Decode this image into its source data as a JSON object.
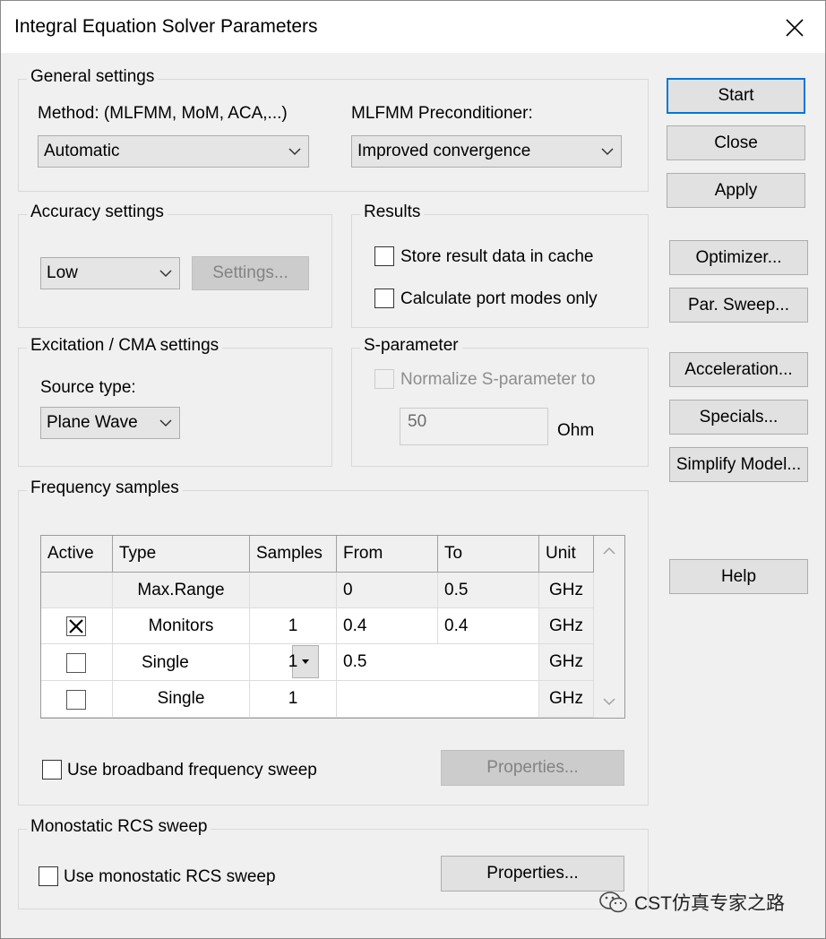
{
  "window": {
    "title": "Integral Equation Solver Parameters"
  },
  "general": {
    "label": "General settings",
    "method_label": "Method: (MLFMM, MoM, ACA,...)",
    "method_value": "Automatic",
    "precond_label": "MLFMM Preconditioner:",
    "precond_value": "Improved convergence"
  },
  "accuracy": {
    "label": "Accuracy settings",
    "value": "Low",
    "settings_button": "Settings..."
  },
  "results": {
    "label": "Results",
    "store_cache": {
      "label": "Store result data in cache",
      "checked": false
    },
    "port_modes": {
      "label": "Calculate port modes only",
      "checked": false
    }
  },
  "excitation": {
    "label": "Excitation / CMA settings",
    "source_label": "Source type:",
    "source_value": "Plane Wave"
  },
  "sparam": {
    "label": "S-parameter",
    "normalize_label": "Normalize S-parameter to",
    "value": "50",
    "unit": "Ohm"
  },
  "freq": {
    "label": "Frequency samples",
    "columns": [
      "Active",
      "Type",
      "Samples",
      "From",
      "To",
      "Unit"
    ],
    "rows": [
      {
        "active": "",
        "type": "Max.Range",
        "samples": "",
        "from": "0",
        "to": "0.5",
        "unit": "GHz"
      },
      {
        "active": "checked",
        "type": "Monitors",
        "samples": "1",
        "from": "0.4",
        "to": "0.4",
        "unit": "GHz"
      },
      {
        "active": "unchecked",
        "type": "Single",
        "samples": "1",
        "from": "0.5",
        "to": "",
        "unit": "GHz"
      },
      {
        "active": "unchecked",
        "type": "Single",
        "samples": "1",
        "from": "",
        "to": "",
        "unit": "GHz"
      }
    ],
    "broadband_label": "Use broadband frequency sweep",
    "properties_button": "Properties..."
  },
  "rcs": {
    "label": "Monostatic RCS sweep",
    "use_label": "Use monostatic RCS sweep",
    "properties_button": "Properties..."
  },
  "buttons": {
    "start": "Start",
    "close": "Close",
    "apply": "Apply",
    "optimizer": "Optimizer...",
    "par_sweep": "Par. Sweep...",
    "acceleration": "Acceleration...",
    "specials": "Specials...",
    "simplify": "Simplify Model...",
    "help": "Help"
  },
  "watermark": "CST仿真专家之路"
}
